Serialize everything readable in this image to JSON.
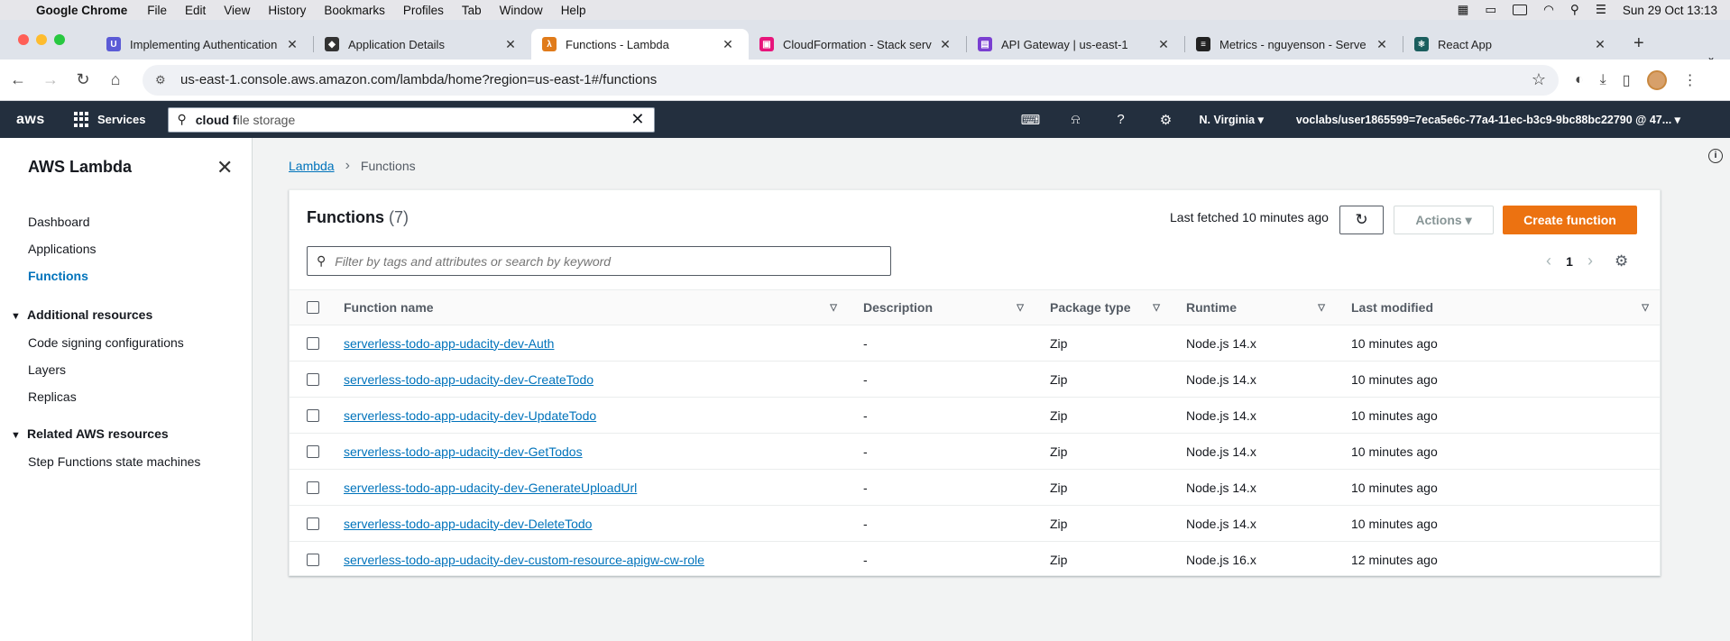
{
  "macos": {
    "app": "Google Chrome",
    "menus": [
      "File",
      "Edit",
      "View",
      "History",
      "Bookmarks",
      "Profiles",
      "Tab",
      "Window",
      "Help"
    ],
    "clock": "Sun 29 Oct  13:13"
  },
  "tabs": [
    {
      "label": "Implementing Authentication",
      "color": "#5b5bd6",
      "active": false
    },
    {
      "label": "Application Details",
      "color": "#333333",
      "active": false
    },
    {
      "label": "Functions - Lambda",
      "color": "#e07b1a",
      "active": true
    },
    {
      "label": "CloudFormation - Stack serv",
      "color": "#e7157b",
      "active": false
    },
    {
      "label": "API Gateway | us-east-1",
      "color": "#7a3fd1",
      "active": false
    },
    {
      "label": "Metrics - nguyenson - Serve",
      "color": "#222222",
      "active": false
    },
    {
      "label": "React App",
      "color": "#1b5e5e",
      "active": false
    }
  ],
  "browser": {
    "url": "us-east-1.console.aws.amazon.com/lambda/home?region=us-east-1#/functions"
  },
  "awsnav": {
    "logo": "aws",
    "services": "Services",
    "search_typed": "cloud f",
    "search_suggest": "ile storage",
    "region": "N. Virginia",
    "account": "voclabs/user1865599=7eca5e6c-77a4-11ec-b3c9-9bc88bc22790 @ 47..."
  },
  "sidebar": {
    "title": "AWS Lambda",
    "items": [
      "Dashboard",
      "Applications",
      "Functions"
    ],
    "active": "Functions",
    "section1": "Additional resources",
    "section1_items": [
      "Code signing configurations",
      "Layers",
      "Replicas"
    ],
    "section2": "Related AWS resources",
    "section2_items": [
      "Step Functions state machines"
    ]
  },
  "breadcrumb": {
    "root": "Lambda",
    "current": "Functions"
  },
  "panel": {
    "title": "Functions",
    "count": "(7)",
    "last_fetched": "Last fetched 10 minutes ago",
    "actions_label": "Actions",
    "create_label": "Create function",
    "filter_placeholder": "Filter by tags and attributes or search by keyword",
    "page": "1"
  },
  "table": {
    "columns": [
      "Function name",
      "Description",
      "Package type",
      "Runtime",
      "Last modified"
    ],
    "rows": [
      {
        "name": "serverless-todo-app-udacity-dev-Auth",
        "description": "-",
        "package": "Zip",
        "runtime": "Node.js 14.x",
        "modified": "10 minutes ago"
      },
      {
        "name": "serverless-todo-app-udacity-dev-CreateTodo",
        "description": "-",
        "package": "Zip",
        "runtime": "Node.js 14.x",
        "modified": "10 minutes ago"
      },
      {
        "name": "serverless-todo-app-udacity-dev-UpdateTodo",
        "description": "-",
        "package": "Zip",
        "runtime": "Node.js 14.x",
        "modified": "10 minutes ago"
      },
      {
        "name": "serverless-todo-app-udacity-dev-GetTodos",
        "description": "-",
        "package": "Zip",
        "runtime": "Node.js 14.x",
        "modified": "10 minutes ago"
      },
      {
        "name": "serverless-todo-app-udacity-dev-GenerateUploadUrl",
        "description": "-",
        "package": "Zip",
        "runtime": "Node.js 14.x",
        "modified": "10 minutes ago"
      },
      {
        "name": "serverless-todo-app-udacity-dev-DeleteTodo",
        "description": "-",
        "package": "Zip",
        "runtime": "Node.js 14.x",
        "modified": "10 minutes ago"
      },
      {
        "name": "serverless-todo-app-udacity-dev-custom-resource-apigw-cw-role",
        "description": "-",
        "package": "Zip",
        "runtime": "Node.js 16.x",
        "modified": "12 minutes ago"
      }
    ]
  },
  "colors": {
    "accent": "#ec7211",
    "link": "#0073bb",
    "nav": "#232f3e"
  }
}
